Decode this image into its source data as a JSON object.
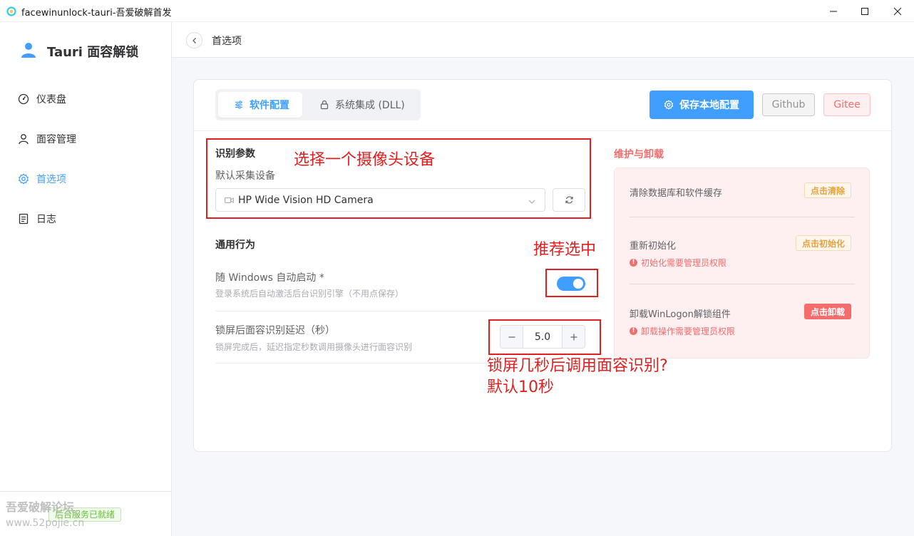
{
  "window": {
    "title": "facewinunlock-tauri-吾爱破解首发"
  },
  "sidebar": {
    "brand": "Tauri 面容解锁",
    "items": [
      {
        "label": "仪表盘",
        "icon": "dashboard-icon",
        "active": false
      },
      {
        "label": "面容管理",
        "icon": "user-icon",
        "active": false
      },
      {
        "label": "首选项",
        "icon": "gear-icon",
        "active": true
      },
      {
        "label": "日志",
        "icon": "document-icon",
        "active": false
      }
    ],
    "status": "后台服务已就绪",
    "watermark_line1": "吾爱破解论坛",
    "watermark_line2": "www.52pojie.cn"
  },
  "header": {
    "title": "首选项"
  },
  "tabs": [
    {
      "label": "软件配置",
      "active": true
    },
    {
      "label": "系统集成 (DLL)",
      "active": false
    }
  ],
  "toolbar": {
    "save_label": "保存本地配置",
    "github_label": "Github",
    "gitee_label": "Gitee"
  },
  "recognition": {
    "title": "识别参数",
    "device_label": "默认采集设备",
    "device_value": "HP Wide Vision HD Camera"
  },
  "general": {
    "title": "通用行为",
    "autostart_label": "随 Windows 自动启动 *",
    "autostart_desc": "登录系统后自动激活后台识别引擎（不用点保存）",
    "autostart_on": true,
    "delay_label": "锁屏后面容识别延迟（秒）",
    "delay_desc": "锁屏完成后，延迟指定秒数调用摄像头进行面容识别",
    "delay_value": "5.0"
  },
  "maintenance": {
    "title": "维护与卸载",
    "items": [
      {
        "label": "清除数据库和软件缓存",
        "button": "点击清除",
        "warning": ""
      },
      {
        "label": "重新初始化",
        "button": "点击初始化",
        "warning": "初始化需要管理员权限"
      },
      {
        "label": "卸载WinLogon解锁组件",
        "button": "点击卸载",
        "warning": "卸载操作需要管理员权限"
      }
    ]
  },
  "annotations": {
    "camera": "选择一个摄像头设备",
    "toggle": "推荐选中",
    "delay_line1": "锁屏几秒后调用面容识别?",
    "delay_line2": "默认10秒"
  },
  "colors": {
    "primary": "#409eff",
    "danger": "#f56c6c",
    "warning": "#e6a23c",
    "success": "#67c23a",
    "annotation": "#e02020"
  }
}
